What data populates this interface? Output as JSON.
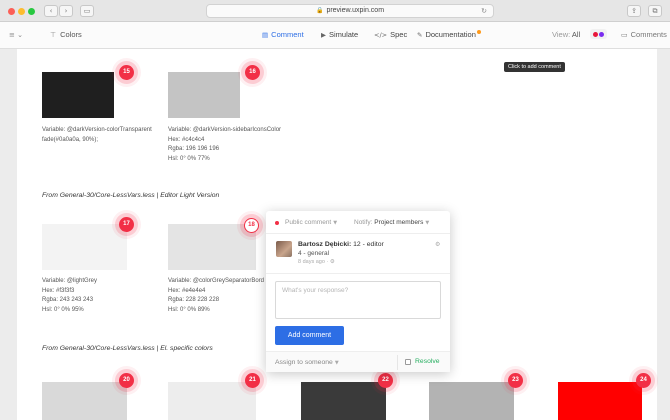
{
  "browser": {
    "url": "preview.uxpin.com",
    "lock_glyph": "🔒",
    "reload_glyph": "↻",
    "back_glyph": "‹",
    "forward_glyph": "›",
    "sidebar_glyph": "▭",
    "share_glyph": "⇪",
    "tabs_glyph": "⧉"
  },
  "toolbar": {
    "menu_glyph": "≡ ⌄",
    "page_icon_glyph": "⊤",
    "page_label": "Colors",
    "tabs": [
      {
        "label": "Comment",
        "icon": "comment-icon",
        "glyph": "▤",
        "active": true
      },
      {
        "label": "Simulate",
        "icon": "play-icon",
        "glyph": "▶",
        "active": false
      },
      {
        "label": "Spec",
        "icon": "code-icon",
        "glyph": "</>",
        "active": false
      },
      {
        "label": "Documentation",
        "icon": "edit-icon",
        "glyph": "✎",
        "active": false
      }
    ],
    "view_label": "View:",
    "view_value": "All",
    "view_dot_colors": [
      "#e8163a",
      "#7a2cf0"
    ],
    "comments_glyph": "▭",
    "comments_label": "Comments"
  },
  "tooltip": "Click to add comment",
  "accent_color": "#f22f46",
  "swatches": [
    {
      "pin": "15",
      "color": "#1f1f1f",
      "lines": [
        "Variable: @darkVersion-colorTransparent",
        "fade(#0a0a0a, 90%);"
      ]
    },
    {
      "pin": "16",
      "color": "#c4c4c4",
      "lines": [
        "Variable: @darkVersion-sidebarIconsColor",
        "Hex: #c4c4c4",
        "Rgba: 196 196 196",
        "Hsl: 0° 0% 77%"
      ]
    },
    {
      "pin": "17",
      "color": "#f3f3f3",
      "lines": [
        "Variable: @lightGrey",
        "Hex: #f3f3f3",
        "Rgba: 243 243 243",
        "Hsl: 0° 0% 95%"
      ]
    },
    {
      "pin": "18",
      "color": "#e4e4e4",
      "lines": [
        "Variable: @colorGreySeparatorBord",
        "Hex: #e4e4e4",
        "Rgba: 228 228 228",
        "Hsl: 0° 0% 89%"
      ]
    },
    {
      "pin": "20",
      "color": "#d9d9d9",
      "lines": []
    },
    {
      "pin": "21",
      "color": "#ededed",
      "lines": []
    },
    {
      "pin": "22",
      "color": "#3a3a3a",
      "lines": []
    },
    {
      "pin": "23",
      "color": "#b3b3b3",
      "lines": []
    },
    {
      "pin": "24",
      "color": "#ff0000",
      "lines": []
    }
  ],
  "sections": [
    "From General-30/Core-LessVars.less | Editor Light Version",
    "From General-30/Core-LessVars.less | El. specific colors"
  ],
  "comment": {
    "visibility": "Public comment",
    "notify_label": "Notify:",
    "notify_value": "Project members",
    "author": "Bartosz Dębicki:",
    "context": "12 - editor",
    "text": "4 - general",
    "time": "8 days ago",
    "response_placeholder": "What's your response?",
    "add_button": "Add comment",
    "assign": "Assign to someone",
    "resolve": "Resolve"
  }
}
